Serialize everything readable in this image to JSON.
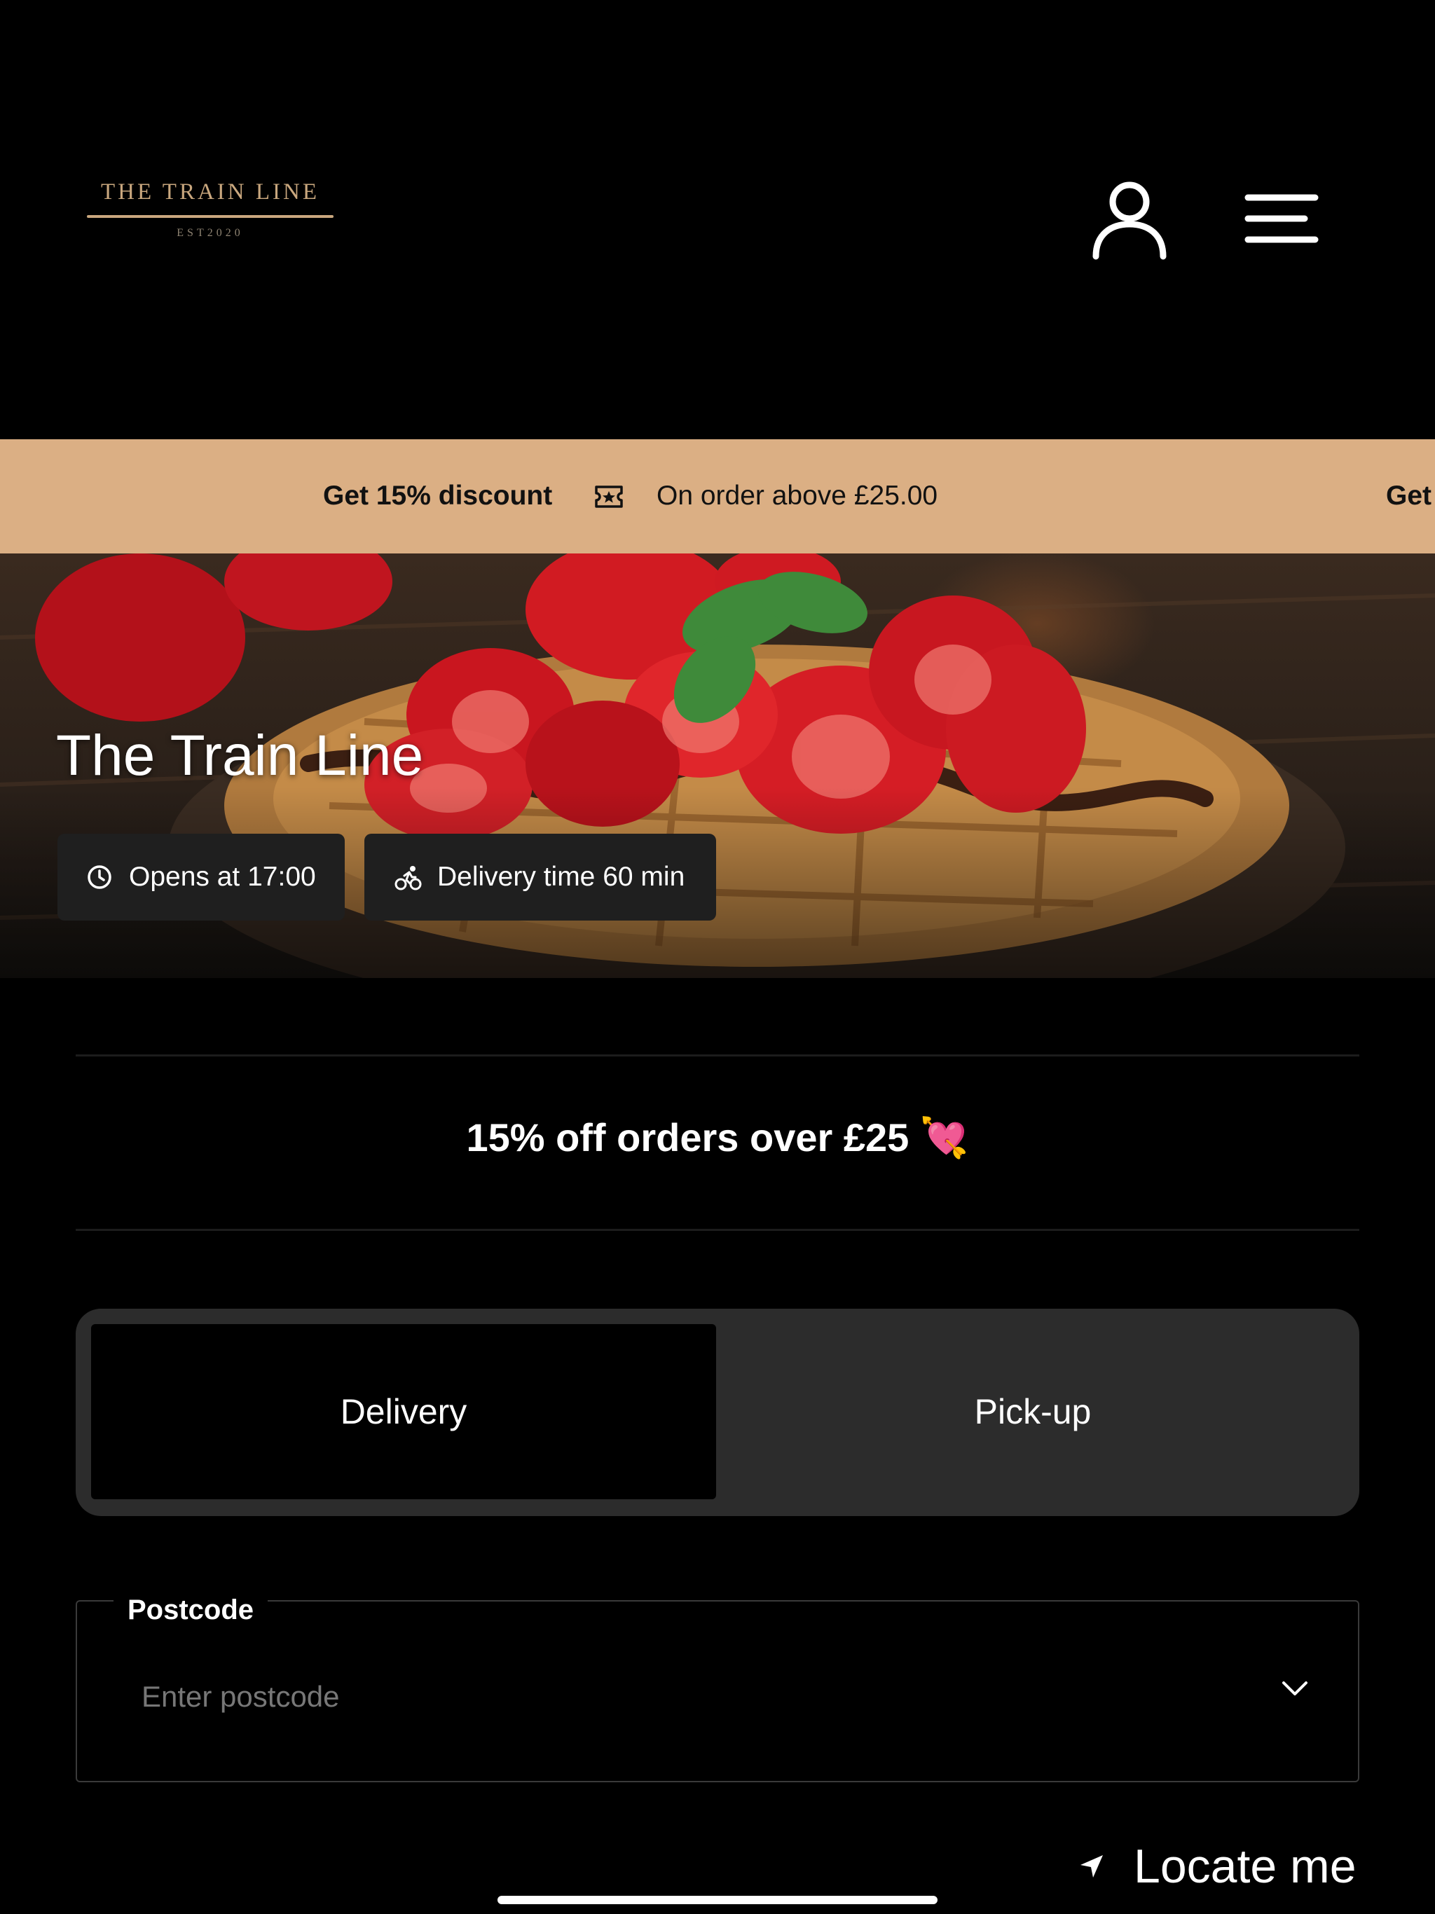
{
  "header": {
    "logo_name": "THE TRAIN LINE",
    "logo_est": "EST2020",
    "account_icon": "user-icon",
    "menu_icon": "hamburger-menu-icon"
  },
  "promo_banner": {
    "headline": "Get 15% discount",
    "detail": "On order above £25.00",
    "repeat_headline": "Get",
    "icon": "ticket-icon",
    "background": "#dbaf84"
  },
  "hero": {
    "title": "The Train Line",
    "hours": "Opens at 17:00",
    "hours_icon": "clock-icon",
    "delivery_time": "Delivery time 60 min",
    "delivery_icon": "bicycle-icon"
  },
  "offer": {
    "text": "15% off orders over £25 💘"
  },
  "order_mode": {
    "selected": "Delivery",
    "delivery_label": "Delivery",
    "pickup_label": "Pick-up"
  },
  "postcode": {
    "label": "Postcode",
    "placeholder": "Enter postcode",
    "value": "",
    "dropdown_icon": "chevron-down-icon"
  },
  "locate": {
    "label": "Locate me",
    "icon": "location-arrow-icon"
  },
  "colors": {
    "background": "#000000",
    "accent_gold": "#c9a77e",
    "toggle_bg": "#2c2c2c",
    "chip_bg": "#1f1f1f"
  }
}
